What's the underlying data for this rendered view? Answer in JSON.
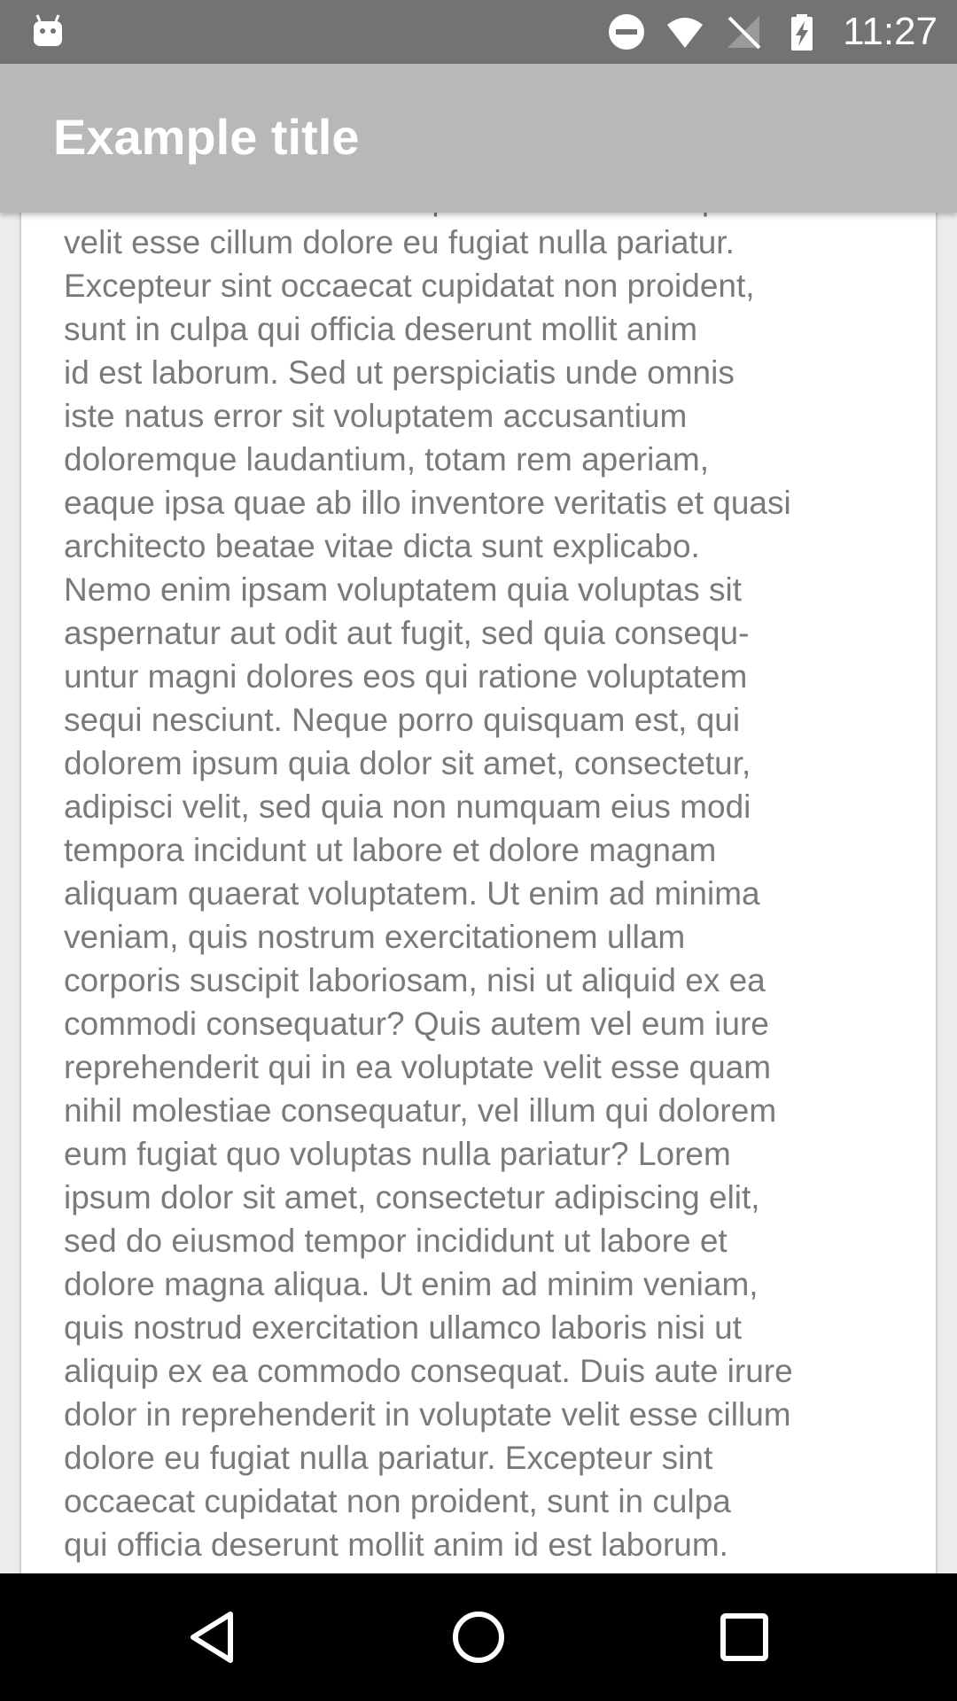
{
  "status_bar": {
    "time": "11:27",
    "icons": [
      "android-icon",
      "do-not-disturb-icon",
      "wifi-icon",
      "no-signal-icon",
      "battery-charging-icon"
    ]
  },
  "app_bar": {
    "title": "Example title"
  },
  "content": {
    "body_text": "Duis aute irure dolor in reprehenderit in voluptate\nvelit esse cillum dolore eu fugiat nulla pariatur.\nExcepteur sint occaecat cupidatat non proident,\nsunt in culpa qui officia deserunt mollit anim\nid est laborum. Sed ut perspiciatis unde omnis\niste natus error sit voluptatem accusantium\ndoloremque laudantium, totam rem aperiam,\neaque ipsa quae ab illo inventore veritatis et quasi\narchitecto beatae vitae dicta sunt explicabo.\nNemo enim ipsam voluptatem quia voluptas sit\naspernatur aut odit aut fugit, sed quia consequ-\nuntur magni dolores eos qui ratione voluptatem\nsequi nesciunt. Neque porro quisquam est, qui\ndolorem ipsum quia dolor sit amet, consectetur,\nadipisci velit, sed quia non numquam eius modi\ntempora incidunt ut labore et dolore magnam\naliquam quaerat voluptatem. Ut enim ad minima\nveniam, quis nostrum exercitationem ullam\ncorporis suscipit laboriosam, nisi ut aliquid ex ea\ncommodi consequatur? Quis autem vel eum iure\nreprehenderit qui in ea voluptate velit esse quam\nnihil molestiae consequatur, vel illum qui dolorem\neum fugiat quo voluptas nulla pariatur? Lorem\nipsum dolor sit amet, consectetur adipiscing elit,\nsed do eiusmod tempor incididunt ut labore et\ndolore magna aliqua. Ut enim ad minim veniam,\nquis nostrud exercitation ullamco laboris nisi ut\naliquip ex ea commodo consequat. Duis aute irure\ndolor in reprehenderit in voluptate velit esse cillum\ndolore eu fugiat nulla pariatur. Excepteur sint\noccaecat cupidatat non proident, sunt in culpa\nqui officia deserunt mollit anim id est laborum."
  },
  "nav_bar": {
    "buttons": [
      "back-icon",
      "home-icon",
      "recents-icon"
    ]
  },
  "colors": {
    "status_bar": "#737373",
    "app_bar": "#b8b8b8",
    "body_text": "#7a7a7a",
    "background": "#ededed",
    "nav_bar": "#000000"
  }
}
